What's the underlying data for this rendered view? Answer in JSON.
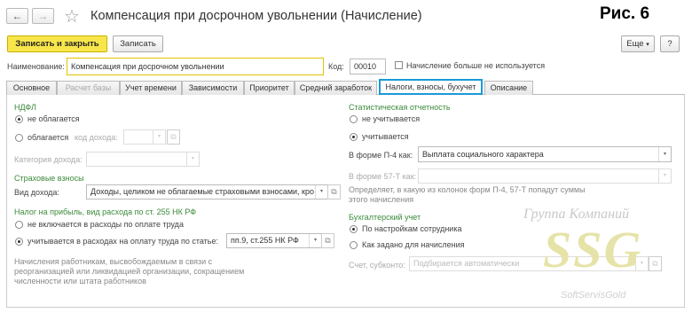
{
  "window": {
    "title": "Компенсация при досрочном увольнении (Начисление)",
    "figure_label": "Рис. 6"
  },
  "nav": {
    "back": "←",
    "forward": "→",
    "star": "☆"
  },
  "toolbar": {
    "save_close": "Записать и закрыть",
    "save": "Записать",
    "more": "Еще",
    "more_arrow": "▾",
    "help": "?"
  },
  "header": {
    "name_label": "Наименование:",
    "name_value": "Компенсация при досрочном увольнении",
    "code_label": "Код:",
    "code_value": "00010",
    "unused_label": "Начисление больше не используется"
  },
  "tabs": [
    {
      "label": "Основное"
    },
    {
      "label": "Расчет базы"
    },
    {
      "label": "Учет времени"
    },
    {
      "label": "Зависимости"
    },
    {
      "label": "Приоритет"
    },
    {
      "label": "Средний заработок"
    },
    {
      "label": "Налоги, взносы, бухучет"
    },
    {
      "label": "Описание"
    }
  ],
  "ndfl": {
    "title": "НДФЛ",
    "not_taxed": "не облагается",
    "taxed": "облагается",
    "income_code_label": "код дохода:",
    "category_label": "Категория дохода:"
  },
  "insurance": {
    "title": "Страховые взносы",
    "income_type_label": "Вид дохода:",
    "income_type_value": "Доходы, целиком не облагаемые страховыми взносами, кро"
  },
  "profit_tax": {
    "title": "Налог на прибыль, вид расхода по ст. 255 НК РФ",
    "not_included": "не включается в расходы по оплате труда",
    "included": "учитывается в расходах на оплату труда по статье:",
    "article_value": "пп.9, ст.255 НК РФ",
    "note": "Начисления работникам, высвобождаемым в связи с реорганизацией или ликвидацией организации, сокращением численности или штата работников"
  },
  "stat": {
    "title": "Статистическая отчетность",
    "not_counted": "не учитывается",
    "counted": "учитывается",
    "p4_label": "В форме П-4 как:",
    "p4_value": "Выплата социального характера",
    "f57_label": "В форме 57-Т как:",
    "note": "Определяет, в какую из колонок форм П-4, 57-Т попадут суммы этого начисления"
  },
  "accounting": {
    "title": "Бухгалтерский учет",
    "by_employee": "По настройкам сотрудника",
    "as_set": "Как задано для начисления",
    "account_label": "Счет, субконто:",
    "account_placeholder": "Подбирается автоматически"
  },
  "watermark": {
    "line1": "Группа Компаний",
    "line2": "SSG",
    "line3": "SoftServisGold"
  }
}
